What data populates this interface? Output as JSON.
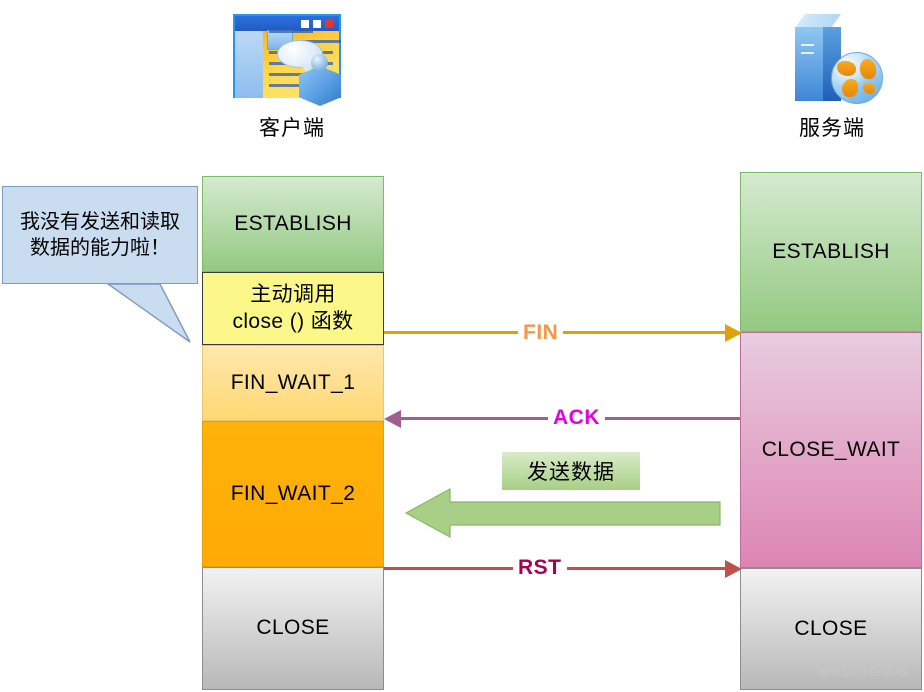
{
  "endpoints": {
    "client": {
      "label": "客户端",
      "icon": "browser-window-user-icon"
    },
    "server": {
      "label": "服务端",
      "icon": "server-tower-globe-icon"
    }
  },
  "client_states": [
    {
      "key": "establish",
      "label": "ESTABLISH",
      "color": "#93c981"
    },
    {
      "key": "close_call",
      "label": "主动调用\nclose () 函数",
      "line1": "主动调用",
      "line2": "close () 函数",
      "color": "#fbf789"
    },
    {
      "key": "fin_wait_1",
      "label": "FIN_WAIT_1",
      "color": "#ffd873"
    },
    {
      "key": "fin_wait_2",
      "label": "FIN_WAIT_2",
      "color": "#ffab05"
    },
    {
      "key": "close",
      "label": "CLOSE",
      "color": "#b8b8b8"
    }
  ],
  "server_states": [
    {
      "key": "establish",
      "label": "ESTABLISH",
      "color": "#93c981"
    },
    {
      "key": "close_wait",
      "label": "CLOSE_WAIT",
      "color": "#dd85b3"
    },
    {
      "key": "close",
      "label": "CLOSE",
      "color": "#b8b8b8"
    }
  ],
  "messages": [
    {
      "key": "fin",
      "label": "FIN",
      "direction": "client-to-server",
      "line_color": "#e0a008",
      "label_color": "#f79646"
    },
    {
      "key": "ack",
      "label": "ACK",
      "direction": "server-to-client",
      "line_color": "#9c5f8e",
      "label_color": "#e600e6"
    },
    {
      "key": "rst",
      "label": "RST",
      "direction": "client-to-server",
      "line_color": "#c0504d",
      "label_color": "#a5024f"
    }
  ],
  "data_flow": {
    "label": "发送数据",
    "direction": "server-to-client",
    "color": "#a8cf86"
  },
  "bubble": {
    "line1": "我没有发送和读取",
    "line2": "数据的能力啦！",
    "fill": "#c9dcf0",
    "border": "#7a9cc0"
  },
  "watermark": {
    "text": "@51CTO博客"
  }
}
